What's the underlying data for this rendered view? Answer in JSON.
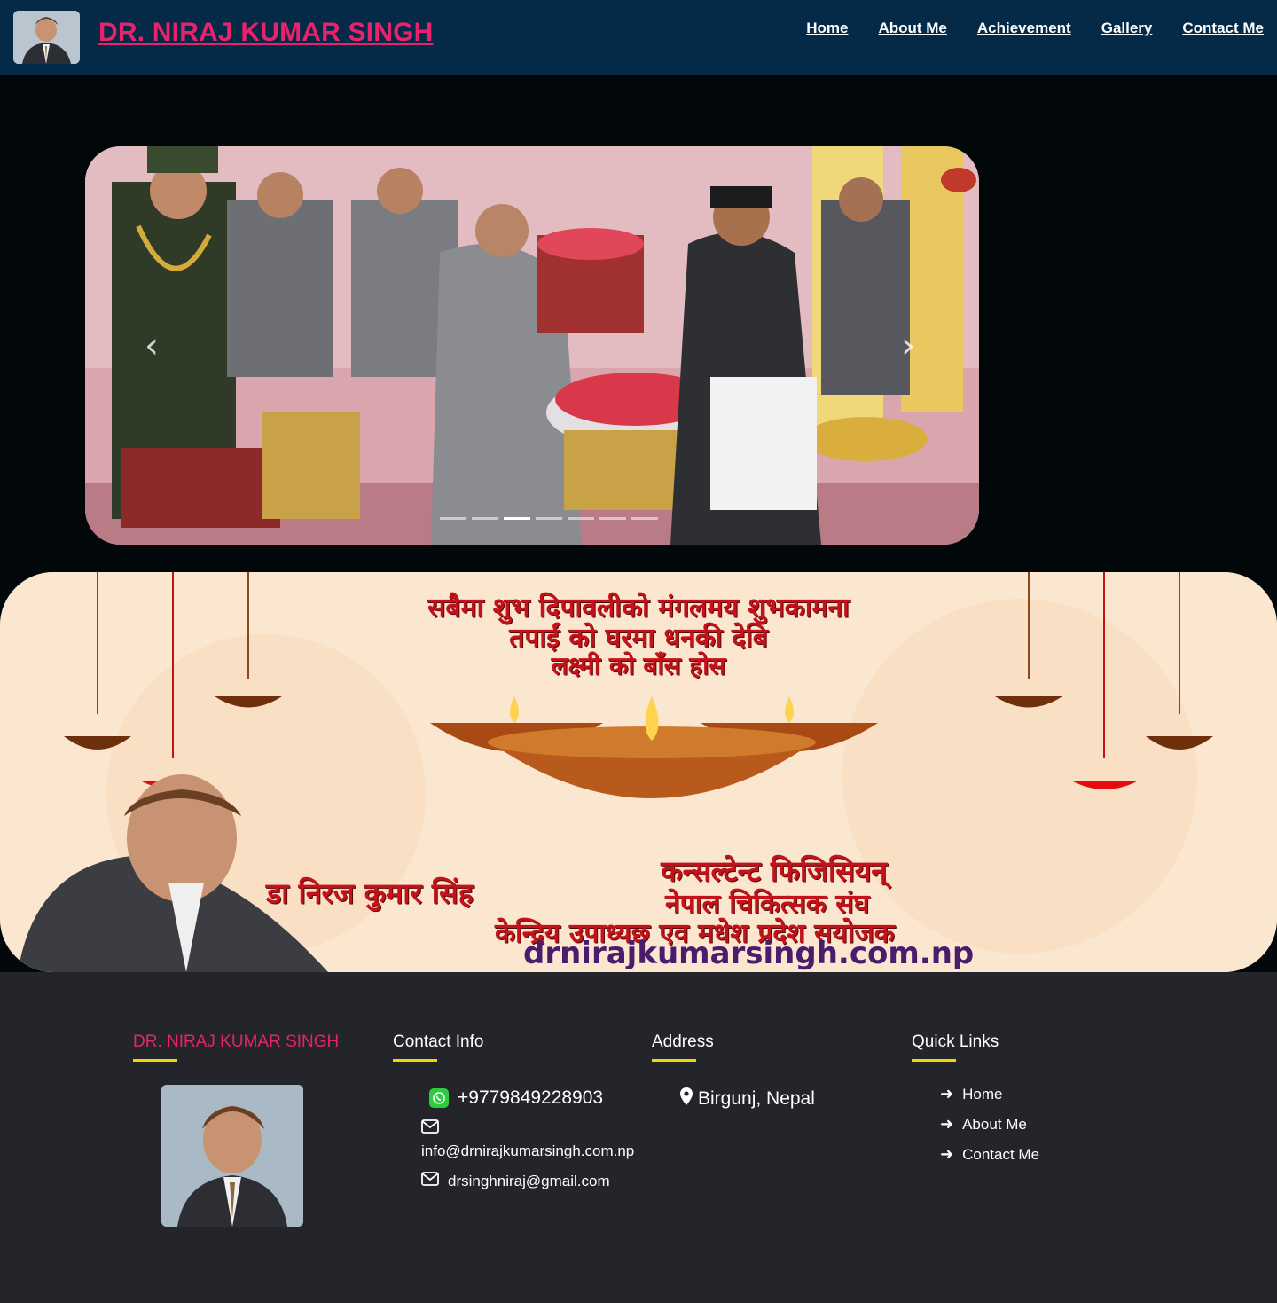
{
  "header": {
    "title": "DR. NIRAJ KUMAR SINGH",
    "nav": [
      "Home",
      "About Me",
      "Achievement",
      "Gallery",
      "Contact Me"
    ]
  },
  "carousel": {
    "prev_icon": "chevron-left-icon",
    "next_icon": "chevron-right-icon",
    "slide_count": 7,
    "active_index": 2
  },
  "banner": {
    "line1": "सबैमा शुभ दिपावलीको मंगलमय शुभकामना",
    "line2": "तपाईं को घरमा धनकी देबि",
    "line3": "लक्ष्मी को बाँस होस",
    "name": "डा निरज कुमार सिंह",
    "role1": "कन्सल्टेन्ट फिजिसियन्",
    "role2": "नेपाल चिकित्सक संघ",
    "role3": "केन्द्रिय उपाध्यछ एव मधेश प्रदेश सयोजक",
    "url": "drnirajkumarsingh.com.np"
  },
  "footer": {
    "brand": "DR. NIRAJ KUMAR SINGH",
    "contact_heading": "Contact Info",
    "phone": "+9779849228903",
    "email1": "info@drnirajkumarsingh.com.np",
    "email2": "drsinghniraj@gmail.com",
    "address_heading": "Address",
    "address": "Birgunj, Nepal",
    "links_heading": "Quick Links",
    "links": [
      "Home",
      "About Me",
      "Contact Me"
    ]
  },
  "colors": {
    "header_bg": "#052a47",
    "brand_pink": "#e8226b",
    "footer_bg": "#23252b",
    "accent_yellow": "#f2d600"
  }
}
